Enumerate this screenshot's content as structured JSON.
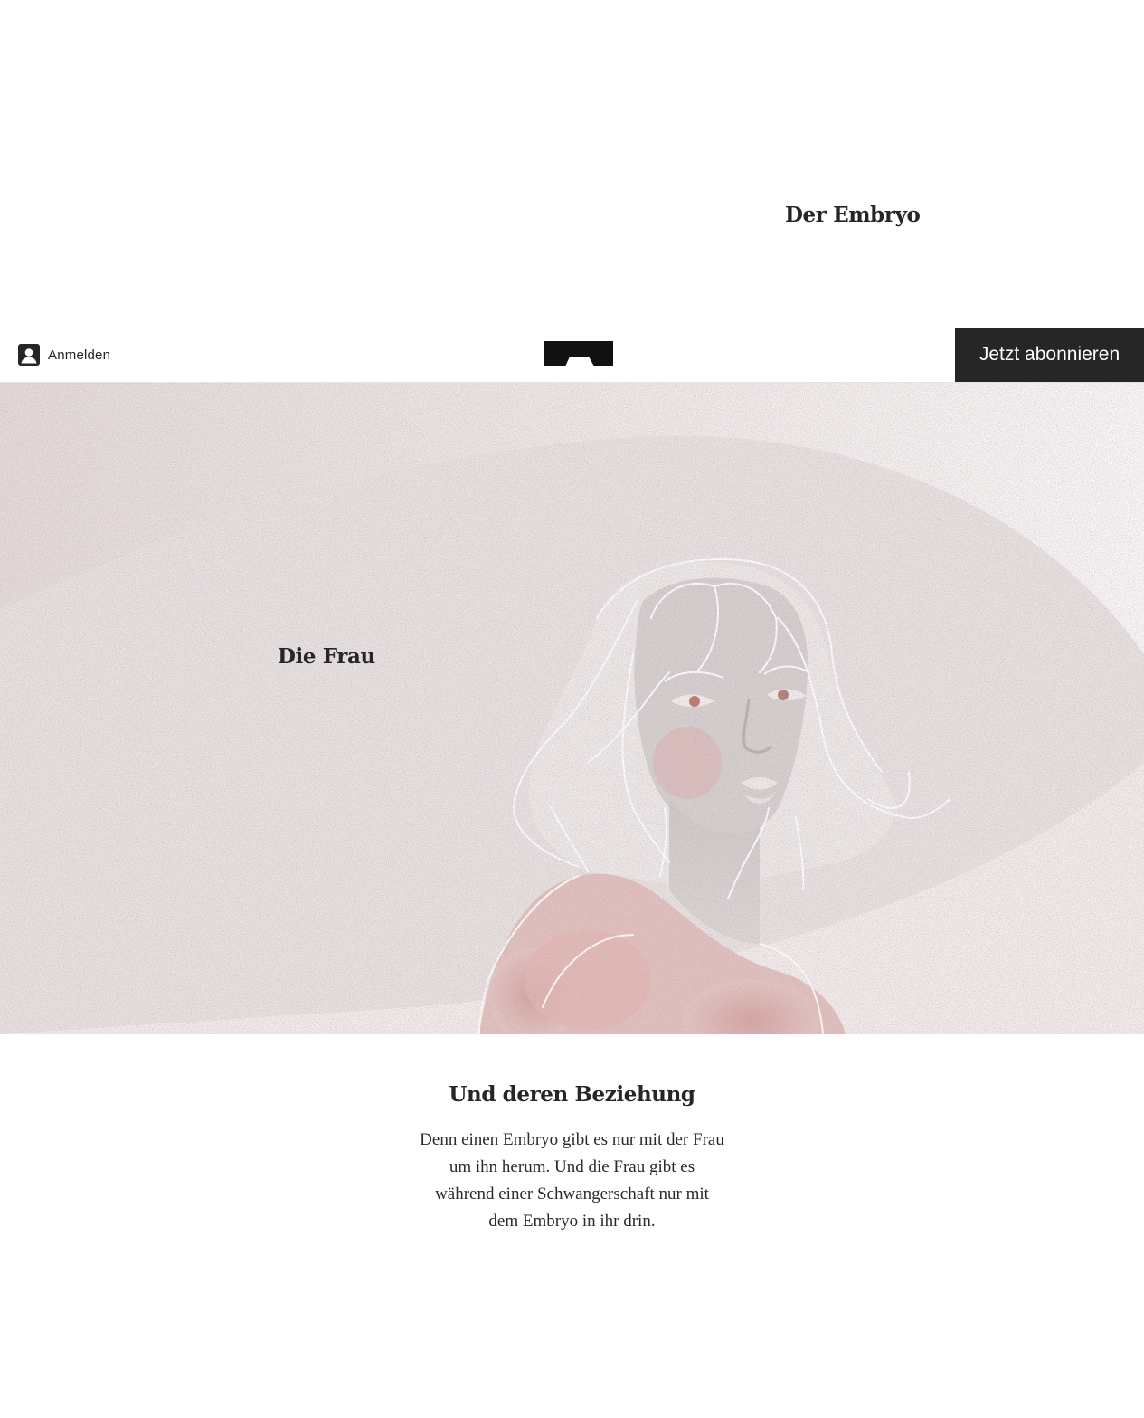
{
  "sections": {
    "embryo_heading": "Der Embryo",
    "frau_heading": "Die Frau",
    "relation_heading": "Und deren Beziehung",
    "relation_text": "Denn einen Embryo gibt es nur mit der Frau um ihn herum. Und die Frau gibt es während einer Schwangerschaft nur mit dem Embryo in ihr drin."
  },
  "header": {
    "login_label": "Anmelden",
    "subscribe_label": "Jetzt abonnieren",
    "login_icon": "user-icon",
    "logo_icon": "crown-logo-icon"
  },
  "colors": {
    "subscribe_bg": "#262626",
    "text": "#262626",
    "hero_bg": "#ebe5e5",
    "skin_accent": "#d9a3a0"
  }
}
